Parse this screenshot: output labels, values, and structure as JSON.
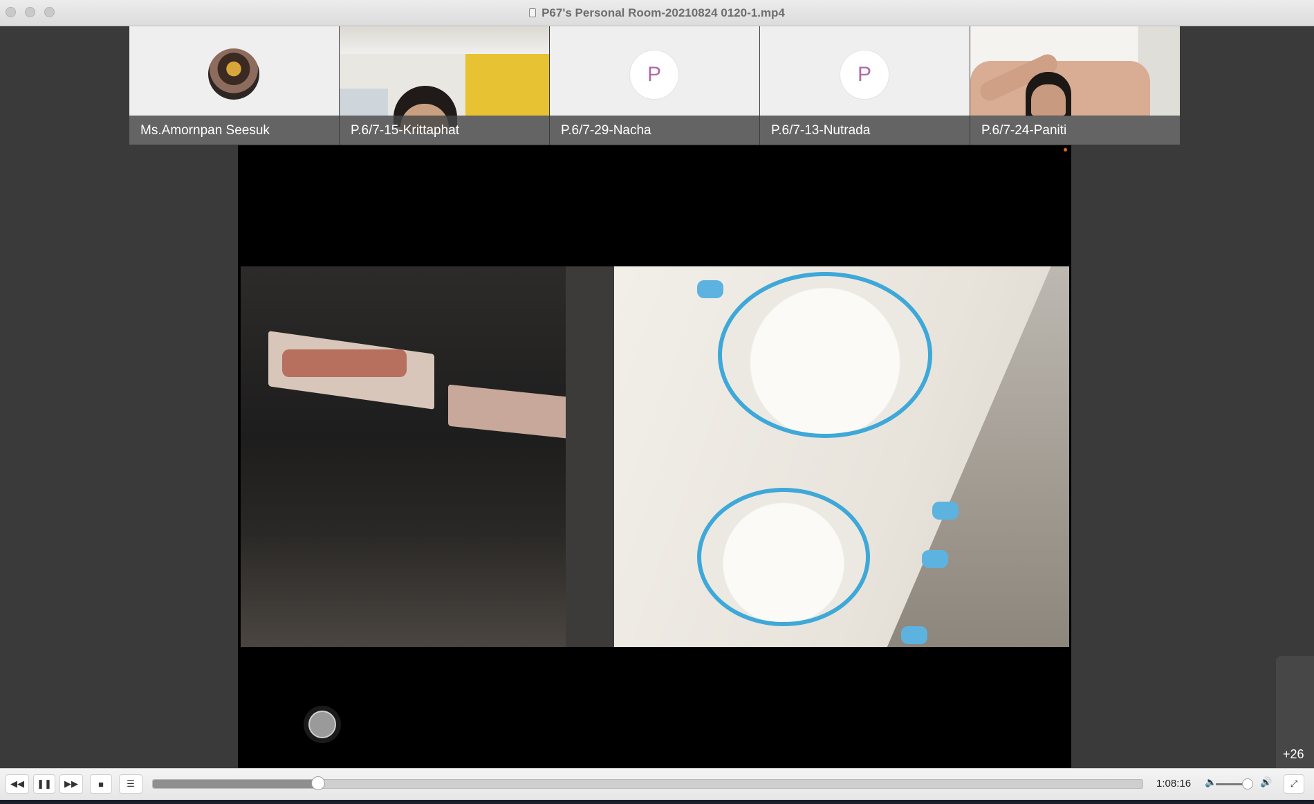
{
  "window": {
    "title": "P67's Personal Room-20210824 0120-1.mp4"
  },
  "participants": [
    {
      "name": "Ms.Amornpan Seesuk",
      "type": "photo-avatar"
    },
    {
      "name": "P.6/7-15-Krittaphat",
      "type": "camera"
    },
    {
      "name": "P.6/7-29-Nacha",
      "type": "initial",
      "initial": "P"
    },
    {
      "name": "P.6/7-13-Nutrada",
      "type": "initial",
      "initial": "P"
    },
    {
      "name": "P.6/7-24-Paniti",
      "type": "camera"
    }
  ],
  "more_participants": "+26",
  "player": {
    "time": "1:08:16",
    "progress": 0.167,
    "volume": 0.88,
    "buttons": {
      "rewind": "rewind-icon",
      "pause": "pause-icon",
      "forward": "fast-forward-icon",
      "stop": "stop-icon",
      "playlist": "playlist-icon",
      "fullscreen": "fullscreen-icon"
    }
  },
  "colors": {
    "accent_dial": "#3ea8d8",
    "initial_text": "#b06aa8",
    "background": "#3a3a3a"
  }
}
